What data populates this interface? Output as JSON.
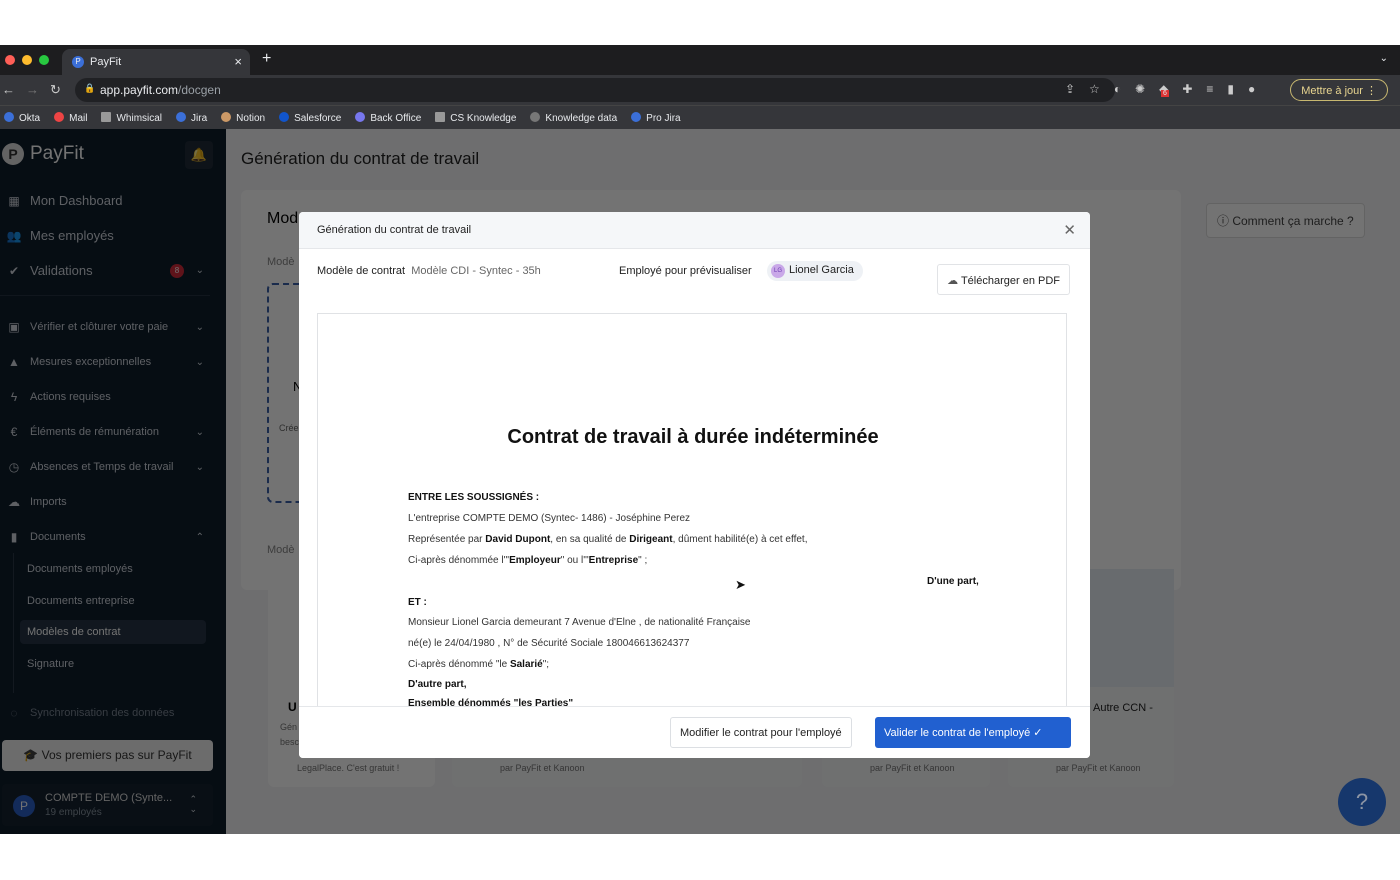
{
  "browser": {
    "tab_title": "PayFit",
    "url_host": "app.payfit.com",
    "url_path": "/docgen",
    "update_label": "Mettre à jour",
    "extension_badge": "6",
    "bookmarks": [
      "Okta",
      "Mail",
      "Whimsical",
      "Jira",
      "Notion",
      "Salesforce",
      "Back Office",
      "CS Knowledge",
      "Knowledge data",
      "Pro Jira"
    ]
  },
  "sidebar": {
    "logo": "PayFit",
    "items": [
      {
        "label": "Mon Dashboard",
        "icon": "dashboard-icon"
      },
      {
        "label": "Mes employés",
        "icon": "people-icon"
      },
      {
        "label": "Validations",
        "icon": "check-circle-icon",
        "badge": "8"
      },
      {
        "label": "Vérifier et clôturer votre paie",
        "icon": "calendar-icon"
      },
      {
        "label": "Mesures exceptionnelles",
        "icon": "warning-icon"
      },
      {
        "label": "Actions requises",
        "icon": "bolt-icon"
      },
      {
        "label": "Éléments de rémunération",
        "icon": "euro-icon"
      },
      {
        "label": "Absences et Temps de travail",
        "icon": "clock-icon"
      },
      {
        "label": "Imports",
        "icon": "cloud-upload-icon"
      },
      {
        "label": "Documents",
        "icon": "document-icon"
      }
    ],
    "sub_items": [
      "Documents employés",
      "Documents entreprise",
      "Modèles de contrat",
      "Signature"
    ],
    "sync": "Synchronisation des données",
    "premiers_pas": "Vos premiers pas sur PayFit",
    "account": {
      "name": "COMPTE DEMO (Synte...",
      "employees": "19 employés"
    }
  },
  "page": {
    "title": "Génération du contrat de travail",
    "help_button": "Comment ça marche ?",
    "section_title": "Mod",
    "section_sub": "Modè",
    "section_sub2": "Modè",
    "card_partial": "N",
    "card_text": "Crée",
    "card_u": "U",
    "card_lines": [
      "Gén",
      "besc",
      "LegalPlace. C'est gratuit !"
    ],
    "other_ccn": "Autre CCN -",
    "kanoon": "par PayFit et Kanoon"
  },
  "modal": {
    "title": "Génération du contrat de travail",
    "model_label": "Modèle de contrat",
    "model_value": "Modèle CDI - Syntec - 35h",
    "employee_label": "Employé pour prévisualiser",
    "employee_initials": "LG",
    "employee_name": "Lionel Garcia",
    "download": "Télécharger en PDF",
    "doc": {
      "title": "Contrat de travail à durée indéterminée",
      "entre": "ENTRE LES SOUSSIGNÉS :",
      "l1": "L'entreprise COMPTE DEMO (Syntec- 1486) - Joséphine Perez",
      "l2a": "Représentée par ",
      "l2b": "David Dupont",
      "l2c": ", en sa qualité de ",
      "l2d": "Dirigeant",
      "l2e": ", dûment habilité(e) à cet effet,",
      "l3a": "Ci-après dénommée l'\"",
      "l3b": "Employeur",
      "l3c": "\" ou l'\"",
      "l3d": "Entreprise",
      "l3e": "\" ;",
      "dune": "D'une part,",
      "et": "ET :",
      "l4": "Monsieur Lionel Garcia demeurant 7 Avenue d'Elne , de nationalité Française",
      "l5": "né(e) le 24/04/1980 , N° de Sécurité Sociale 180046613624377",
      "l6a": "Ci-après dénommé \"le ",
      "l6b": "Salarié",
      "l6c": "\";",
      "dautre": "D'autre part,",
      "ensemble": "Ensemble dénommés \"les Parties\""
    },
    "modify": "Modifier le contrat pour l'employé",
    "validate": "Valider le contrat de l'employé"
  }
}
